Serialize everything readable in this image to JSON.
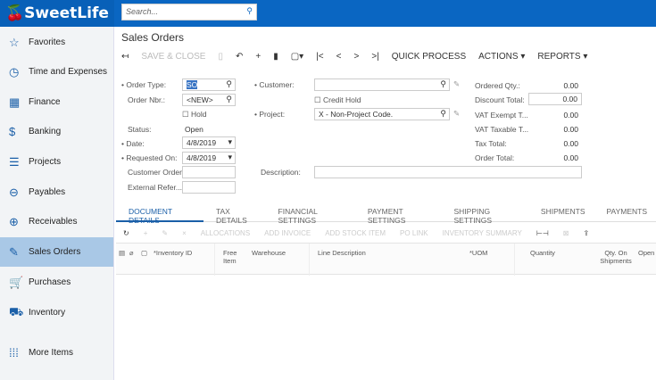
{
  "app": {
    "logo": "SweetLife",
    "search_placeholder": "Search..."
  },
  "sidebar": {
    "items": [
      {
        "label": "Favorites",
        "icon": "star-icon"
      },
      {
        "label": "Time and Expenses",
        "icon": "clock-icon"
      },
      {
        "label": "Finance",
        "icon": "calculator-icon"
      },
      {
        "label": "Banking",
        "icon": "dollar-icon"
      },
      {
        "label": "Projects",
        "icon": "projects-icon"
      },
      {
        "label": "Payables",
        "icon": "minus-circle-icon"
      },
      {
        "label": "Receivables",
        "icon": "plus-circle-icon"
      },
      {
        "label": "Sales Orders",
        "icon": "edit-icon",
        "selected": true
      },
      {
        "label": "Purchases",
        "icon": "cart-icon"
      },
      {
        "label": "Inventory",
        "icon": "truck-icon"
      },
      {
        "label": "More Items",
        "icon": "grid-dots-icon"
      }
    ]
  },
  "page": {
    "title": "Sales Orders"
  },
  "toolbar": {
    "save_close": "SAVE & CLOSE",
    "quick_process": "QUICK PROCESS",
    "actions": "ACTIONS",
    "reports": "REPORTS"
  },
  "form": {
    "order_type_label": "Order Type:",
    "order_type": "SO",
    "order_nbr_label": "Order Nbr.:",
    "order_nbr": "<NEW>",
    "hold_label": "Hold",
    "status_label": "Status:",
    "status": "Open",
    "date_label": "Date:",
    "date": "4/8/2019",
    "requested_on_label": "Requested On:",
    "requested_on": "4/8/2019",
    "customer_order_label": "Customer Order:",
    "external_ref_label": "External Refer...",
    "customer_label": "Customer:",
    "customer": "",
    "credit_hold_label": "Credit Hold",
    "project_label": "Project:",
    "project": "X - Non-Project Code.",
    "description_label": "Description:",
    "description": ""
  },
  "totals": [
    {
      "label": "Ordered Qty.:",
      "value": "0.00"
    },
    {
      "label": "Discount Total:",
      "value": "0.00"
    },
    {
      "label": "VAT Exempt T...",
      "value": "0.00"
    },
    {
      "label": "VAT Taxable T...",
      "value": "0.00"
    },
    {
      "label": "Tax Total:",
      "value": "0.00"
    },
    {
      "label": "Order Total:",
      "value": "0.00"
    }
  ],
  "tabs": [
    "DOCUMENT DETAILS",
    "TAX DETAILS",
    "FINANCIAL SETTINGS",
    "PAYMENT SETTINGS",
    "SHIPPING SETTINGS",
    "SHIPMENTS",
    "PAYMENTS"
  ],
  "grid_toolbar": [
    "ALLOCATIONS",
    "ADD INVOICE",
    "ADD STOCK ITEM",
    "PO LINK",
    "INVENTORY SUMMARY"
  ],
  "columns": [
    "*Inventory ID",
    "Free Item",
    "Warehouse",
    "Line Description",
    "*UOM",
    "Quantity",
    "Qty. On Shipments",
    "Open Q"
  ]
}
